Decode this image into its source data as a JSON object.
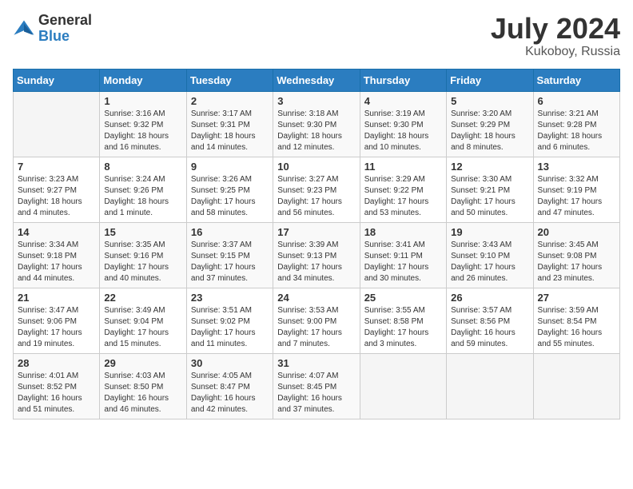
{
  "logo": {
    "line1": "General",
    "line2": "Blue"
  },
  "title": "July 2024",
  "subtitle": "Kukoboy, Russia",
  "weekdays": [
    "Sunday",
    "Monday",
    "Tuesday",
    "Wednesday",
    "Thursday",
    "Friday",
    "Saturday"
  ],
  "weeks": [
    [
      {
        "day": "",
        "info": ""
      },
      {
        "day": "1",
        "info": "Sunrise: 3:16 AM\nSunset: 9:32 PM\nDaylight: 18 hours\nand 16 minutes."
      },
      {
        "day": "2",
        "info": "Sunrise: 3:17 AM\nSunset: 9:31 PM\nDaylight: 18 hours\nand 14 minutes."
      },
      {
        "day": "3",
        "info": "Sunrise: 3:18 AM\nSunset: 9:30 PM\nDaylight: 18 hours\nand 12 minutes."
      },
      {
        "day": "4",
        "info": "Sunrise: 3:19 AM\nSunset: 9:30 PM\nDaylight: 18 hours\nand 10 minutes."
      },
      {
        "day": "5",
        "info": "Sunrise: 3:20 AM\nSunset: 9:29 PM\nDaylight: 18 hours\nand 8 minutes."
      },
      {
        "day": "6",
        "info": "Sunrise: 3:21 AM\nSunset: 9:28 PM\nDaylight: 18 hours\nand 6 minutes."
      }
    ],
    [
      {
        "day": "7",
        "info": "Sunrise: 3:23 AM\nSunset: 9:27 PM\nDaylight: 18 hours\nand 4 minutes."
      },
      {
        "day": "8",
        "info": "Sunrise: 3:24 AM\nSunset: 9:26 PM\nDaylight: 18 hours\nand 1 minute."
      },
      {
        "day": "9",
        "info": "Sunrise: 3:26 AM\nSunset: 9:25 PM\nDaylight: 17 hours\nand 58 minutes."
      },
      {
        "day": "10",
        "info": "Sunrise: 3:27 AM\nSunset: 9:23 PM\nDaylight: 17 hours\nand 56 minutes."
      },
      {
        "day": "11",
        "info": "Sunrise: 3:29 AM\nSunset: 9:22 PM\nDaylight: 17 hours\nand 53 minutes."
      },
      {
        "day": "12",
        "info": "Sunrise: 3:30 AM\nSunset: 9:21 PM\nDaylight: 17 hours\nand 50 minutes."
      },
      {
        "day": "13",
        "info": "Sunrise: 3:32 AM\nSunset: 9:19 PM\nDaylight: 17 hours\nand 47 minutes."
      }
    ],
    [
      {
        "day": "14",
        "info": "Sunrise: 3:34 AM\nSunset: 9:18 PM\nDaylight: 17 hours\nand 44 minutes."
      },
      {
        "day": "15",
        "info": "Sunrise: 3:35 AM\nSunset: 9:16 PM\nDaylight: 17 hours\nand 40 minutes."
      },
      {
        "day": "16",
        "info": "Sunrise: 3:37 AM\nSunset: 9:15 PM\nDaylight: 17 hours\nand 37 minutes."
      },
      {
        "day": "17",
        "info": "Sunrise: 3:39 AM\nSunset: 9:13 PM\nDaylight: 17 hours\nand 34 minutes."
      },
      {
        "day": "18",
        "info": "Sunrise: 3:41 AM\nSunset: 9:11 PM\nDaylight: 17 hours\nand 30 minutes."
      },
      {
        "day": "19",
        "info": "Sunrise: 3:43 AM\nSunset: 9:10 PM\nDaylight: 17 hours\nand 26 minutes."
      },
      {
        "day": "20",
        "info": "Sunrise: 3:45 AM\nSunset: 9:08 PM\nDaylight: 17 hours\nand 23 minutes."
      }
    ],
    [
      {
        "day": "21",
        "info": "Sunrise: 3:47 AM\nSunset: 9:06 PM\nDaylight: 17 hours\nand 19 minutes."
      },
      {
        "day": "22",
        "info": "Sunrise: 3:49 AM\nSunset: 9:04 PM\nDaylight: 17 hours\nand 15 minutes."
      },
      {
        "day": "23",
        "info": "Sunrise: 3:51 AM\nSunset: 9:02 PM\nDaylight: 17 hours\nand 11 minutes."
      },
      {
        "day": "24",
        "info": "Sunrise: 3:53 AM\nSunset: 9:00 PM\nDaylight: 17 hours\nand 7 minutes."
      },
      {
        "day": "25",
        "info": "Sunrise: 3:55 AM\nSunset: 8:58 PM\nDaylight: 17 hours\nand 3 minutes."
      },
      {
        "day": "26",
        "info": "Sunrise: 3:57 AM\nSunset: 8:56 PM\nDaylight: 16 hours\nand 59 minutes."
      },
      {
        "day": "27",
        "info": "Sunrise: 3:59 AM\nSunset: 8:54 PM\nDaylight: 16 hours\nand 55 minutes."
      }
    ],
    [
      {
        "day": "28",
        "info": "Sunrise: 4:01 AM\nSunset: 8:52 PM\nDaylight: 16 hours\nand 51 minutes."
      },
      {
        "day": "29",
        "info": "Sunrise: 4:03 AM\nSunset: 8:50 PM\nDaylight: 16 hours\nand 46 minutes."
      },
      {
        "day": "30",
        "info": "Sunrise: 4:05 AM\nSunset: 8:47 PM\nDaylight: 16 hours\nand 42 minutes."
      },
      {
        "day": "31",
        "info": "Sunrise: 4:07 AM\nSunset: 8:45 PM\nDaylight: 16 hours\nand 37 minutes."
      },
      {
        "day": "",
        "info": ""
      },
      {
        "day": "",
        "info": ""
      },
      {
        "day": "",
        "info": ""
      }
    ]
  ]
}
